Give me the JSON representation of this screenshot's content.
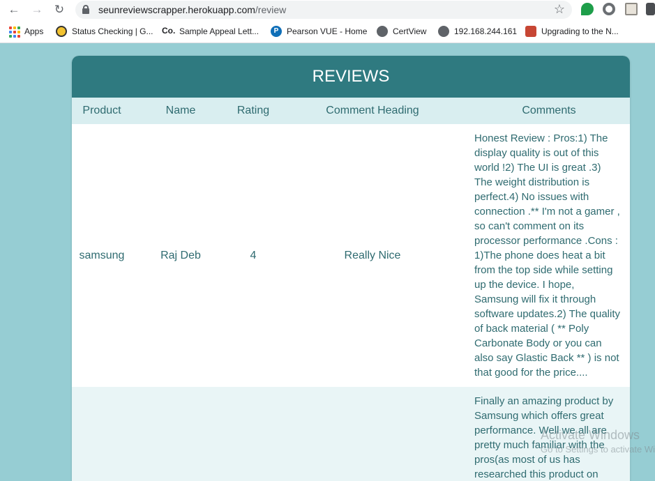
{
  "browser": {
    "url_host": "seunreviewscrapper.herokuapp.com",
    "url_path": "/review",
    "bookmarks": [
      {
        "label": "Apps",
        "icon": "apps-grid-icon"
      },
      {
        "label": "Status Checking | G...",
        "icon": "bee-icon"
      },
      {
        "label": "Sample Appeal Lett...",
        "icon": "co-icon"
      },
      {
        "label": "Pearson VUE - Home",
        "icon": "pearson-icon"
      },
      {
        "label": "CertView",
        "icon": "globe-icon"
      },
      {
        "label": "192.168.244.161",
        "icon": "globe-icon"
      },
      {
        "label": "Upgrading to the N...",
        "icon": "oracle-icon"
      }
    ]
  },
  "page": {
    "title": "REVIEWS",
    "columns": [
      "Product",
      "Name",
      "Rating",
      "Comment Heading",
      "Comments"
    ],
    "rows": [
      {
        "product": "samsung",
        "name": "Raj Deb",
        "rating": "4",
        "heading": "Really Nice",
        "comment": "Honest Review : Pros:1) The display quality is out of this world !2) The UI is great .3) The weight distribution is perfect.4) No issues with connection .** I'm not a gamer , so can't comment on its processor performance .Cons : 1)The phone does heat a bit from the top side while setting up the device. I hope, Samsung will fix it through software updates.2) The quality of back material ( ** Poly Carbonate Body or you can also say Glastic Back ** ) is not that good for the price...."
      },
      {
        "product": "",
        "name": "",
        "rating": "",
        "heading": "",
        "comment": "Finally an amazing product by Samsung which offers great performance. Well we all are pretty much familiar with the pros(as most of us has researched this product on"
      }
    ]
  },
  "watermark": {
    "line1": "Activate Windows",
    "line2": "Go to Settings to activate Windows."
  },
  "colors": {
    "page_bg": "#96cdd3",
    "header_bg": "#2f7a80",
    "thead_bg": "#d9eef0",
    "text": "#2f6b70"
  }
}
